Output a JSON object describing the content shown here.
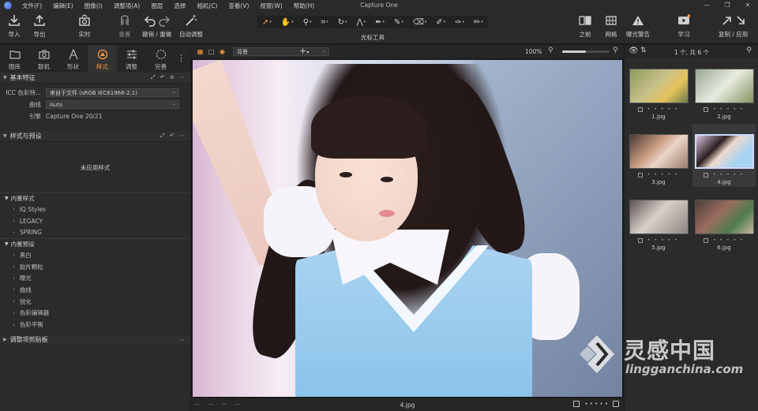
{
  "window": {
    "title": "Capture One",
    "menus": [
      "文件(F)",
      "编辑(E)",
      "图像(I)",
      "调整项(A)",
      "图层",
      "选择",
      "相机(C)",
      "查看(V)",
      "视窗(W)",
      "帮助(H)"
    ],
    "controls": [
      "—",
      "❐",
      "✕"
    ]
  },
  "toolbar": {
    "import": "导入",
    "export": "导出",
    "live": "实时",
    "redo": "重置",
    "undo_redo": "撤销 / 重做",
    "auto_adjust": "自动调整",
    "cursor_tools_label": "光标工具",
    "before": "之前",
    "grid": "网格",
    "exposure_warning": "曝光警告",
    "learn": "学习",
    "copy_apply": "复制 / 应用"
  },
  "tool_tabs": [
    {
      "label": "图库",
      "icon": "library-icon"
    },
    {
      "label": "联机",
      "icon": "camera-icon"
    },
    {
      "label": "形状",
      "icon": "lens-icon"
    },
    {
      "label": "样式",
      "icon": "style-icon",
      "active": true
    },
    {
      "label": "调整",
      "icon": "sliders-icon"
    },
    {
      "label": "完善",
      "icon": "refine-icon"
    }
  ],
  "basic_features": {
    "title": "基本特征",
    "icc_label": "ICC 色彩特...",
    "icc_value": "来自于文件 (sRGB IEC61966-2.1)",
    "curve_label": "曲线",
    "curve_value": "Auto",
    "engine_label": "引擎",
    "engine_value": "Capture One 20/21"
  },
  "styles_presets": {
    "title": "样式与预设",
    "no_style": "未应用样式",
    "builtin_styles_label": "内置样式",
    "builtin_styles": [
      "IQ Styles",
      "LEGACY",
      "SPRING"
    ],
    "builtin_presets_label": "内置预设",
    "builtin_presets": [
      "黑白",
      "胶片颗粒",
      "曝光",
      "曲线",
      "锐化",
      "色彩编辑器",
      "色彩平衡"
    ]
  },
  "clipboard_section": {
    "title": "调整项剪贴板"
  },
  "viewer": {
    "background_select": "背景",
    "zoom": "100%",
    "zoom_fraction": 0.5,
    "status_dashes": [
      "--",
      "--",
      "--",
      "--"
    ],
    "filename": "4.jpg"
  },
  "browser": {
    "count": "1 个, 共 6 个",
    "thumbnails": [
      {
        "name": "1.jpg",
        "selected": false
      },
      {
        "name": "2.jpg",
        "selected": false
      },
      {
        "name": "3.jpg",
        "selected": false
      },
      {
        "name": "4.jpg",
        "selected": true
      },
      {
        "name": "5.jpg",
        "selected": false
      },
      {
        "name": "6.jpg",
        "selected": false
      }
    ]
  },
  "watermark": {
    "cn": "灵感中国",
    "en": "lingganchina.com"
  },
  "colors": {
    "accent": "#ff9b3d",
    "panel": "#2b2b2b",
    "toolbar": "#2a2a2a"
  }
}
